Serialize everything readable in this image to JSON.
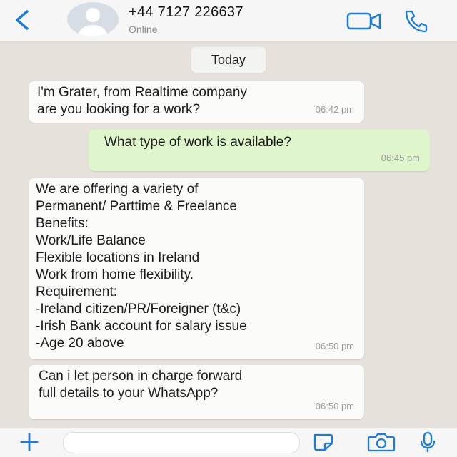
{
  "header": {
    "contact_name": "+44 7127 226637",
    "status": "Online"
  },
  "chat": {
    "date_label": "Today",
    "messages": [
      {
        "direction": "incoming",
        "text": "I'm Grater, from Realtime company\nare you looking for a work?",
        "time": "06:42 pm"
      },
      {
        "direction": "outgoing",
        "text": "What type of work is available?",
        "time": "06:45 pm"
      },
      {
        "direction": "incoming",
        "text": " We are offering a variety of\nPermanent/ Parttime & Freelance\nBenefits:\nWork/Life Balance\nFlexible locations in Ireland\nWork from home flexibility.\nRequirement:\n-Ireland citizen/PR/Foreigner (t&c)\n-Irish Bank account for salary issue\n-Age 20 above",
        "time": "06:50 pm"
      },
      {
        "direction": "incoming",
        "text": "Can i let person in charge forward\nfull details to your WhatsApp?",
        "time": "06:50 pm"
      }
    ]
  },
  "icons": {
    "back": "chevron-left-icon",
    "video": "video-camera-icon",
    "call": "phone-icon",
    "plus": "plus-icon",
    "sticker": "sticker-icon",
    "camera": "camera-icon",
    "mic": "microphone-icon"
  },
  "colors": {
    "accent": "#1e7bd6",
    "chat_background": "#e6e1da",
    "incoming_bubble": "#fbfbfa",
    "outgoing_bubble": "#dff5cb"
  }
}
